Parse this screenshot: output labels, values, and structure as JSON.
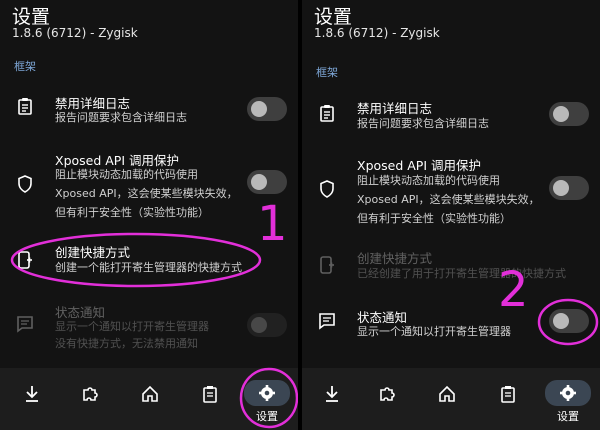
{
  "left": {
    "title": "设置",
    "subtitle": "1.8.6 (6712) - Zygisk",
    "section": "框架",
    "rows": [
      {
        "title": "禁用详细日志",
        "desc1": "报告问题要求包含详细日志"
      },
      {
        "title": "Xposed API 调用保护",
        "desc1": "阻止模块动态加载的代码使用",
        "desc2": "Xposed API，这会使某些模块失效，",
        "desc3": "但有利于安全性（实验性功能）"
      },
      {
        "title": "创建快捷方式",
        "desc1": "创建一个能打开寄生管理器的快捷方式"
      },
      {
        "title": "状态通知",
        "desc1": "显示一个通知以打开寄生管理器",
        "desc2": "没有快捷方式，无法禁用通知"
      }
    ],
    "nav_label": "设置",
    "annotation_number": "1"
  },
  "right": {
    "title": "设置",
    "subtitle": "1.8.6 (6712) - Zygisk",
    "section": "框架",
    "rows": [
      {
        "title": "禁用详细日志",
        "desc1": "报告问题要求包含详细日志"
      },
      {
        "title": "Xposed API 调用保护",
        "desc1": "阻止模块动态加载的代码使用",
        "desc2": "Xposed API，这会使某些模块失效，",
        "desc3": "但有利于安全性（实验性功能）"
      },
      {
        "title": "创建快捷方式",
        "desc1": "已经创建了用于打开寄生管理器的快捷方式"
      },
      {
        "title": "状态通知",
        "desc1": "显示一个通知以打开寄生管理器"
      }
    ],
    "nav_label": "设置",
    "annotation_number": "2"
  },
  "colors": {
    "accent_annotation": "#e22fd9",
    "section_label": "#7da6d6"
  }
}
